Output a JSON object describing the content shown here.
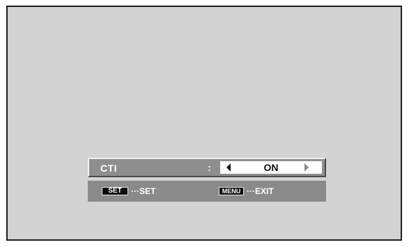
{
  "osd": {
    "setting": {
      "label": "CTI",
      "separator": ":",
      "value": "ON",
      "left_arrow_icon": "left-triangle-icon",
      "right_arrow_icon": "right-triangle-icon"
    },
    "help": {
      "set_key": "SET",
      "set_text": "···SET",
      "menu_key": "MENU",
      "exit_text": "···EXIT"
    }
  },
  "colors": {
    "screen_background": "#d3d3d3",
    "osd_bar": "#8e8e8e",
    "text": "#ffffff"
  }
}
